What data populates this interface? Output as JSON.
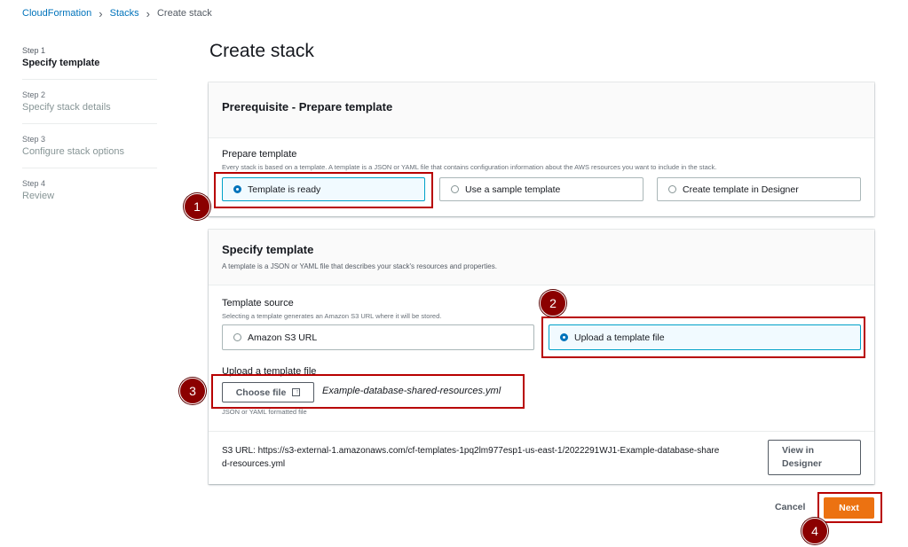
{
  "breadcrumb": {
    "root": "CloudFormation",
    "stacks": "Stacks",
    "current": "Create stack"
  },
  "steps": [
    {
      "num": "Step 1",
      "label": "Specify template"
    },
    {
      "num": "Step 2",
      "label": "Specify stack details"
    },
    {
      "num": "Step 3",
      "label": "Configure stack options"
    },
    {
      "num": "Step 4",
      "label": "Review"
    }
  ],
  "page_title": "Create stack",
  "prerequisite": {
    "heading": "Prerequisite - Prepare template",
    "field_label": "Prepare template",
    "field_desc": "Every stack is based on a template. A template is a JSON or YAML file that contains configuration information about the AWS resources you want to include in the stack.",
    "options": [
      "Template is ready",
      "Use a sample template",
      "Create template in Designer"
    ],
    "selected": "Template is ready"
  },
  "specify": {
    "heading": "Specify template",
    "desc": "A template is a JSON or YAML file that describes your stack's resources and properties.",
    "source_label": "Template source",
    "source_desc": "Selecting a template generates an Amazon S3 URL where it will be stored.",
    "source_options": [
      "Amazon S3 URL",
      "Upload a template file"
    ],
    "source_selected": "Upload a template file",
    "upload_label": "Upload a template file",
    "choose_file": "Choose file",
    "file_name": "Example-database-shared-resources.yml",
    "file_hint": "JSON or YAML formatted file",
    "s3_label": "S3 URL:",
    "s3_url_line1": "https://s3-external-1.amazonaws.com/cf-templates-1pq2lm977esp1-us-east-1/2022291WJ1-Example-database-share",
    "s3_url_line2": "d-resources.yml",
    "view_designer_1": "View in",
    "view_designer_2": "Designer"
  },
  "actions": {
    "cancel": "Cancel",
    "next": "Next"
  },
  "annotations": [
    "1",
    "2",
    "3",
    "4"
  ],
  "colors": {
    "accent": "#0073bb",
    "primary_button": "#ec7211",
    "annotation": "#b80000"
  }
}
